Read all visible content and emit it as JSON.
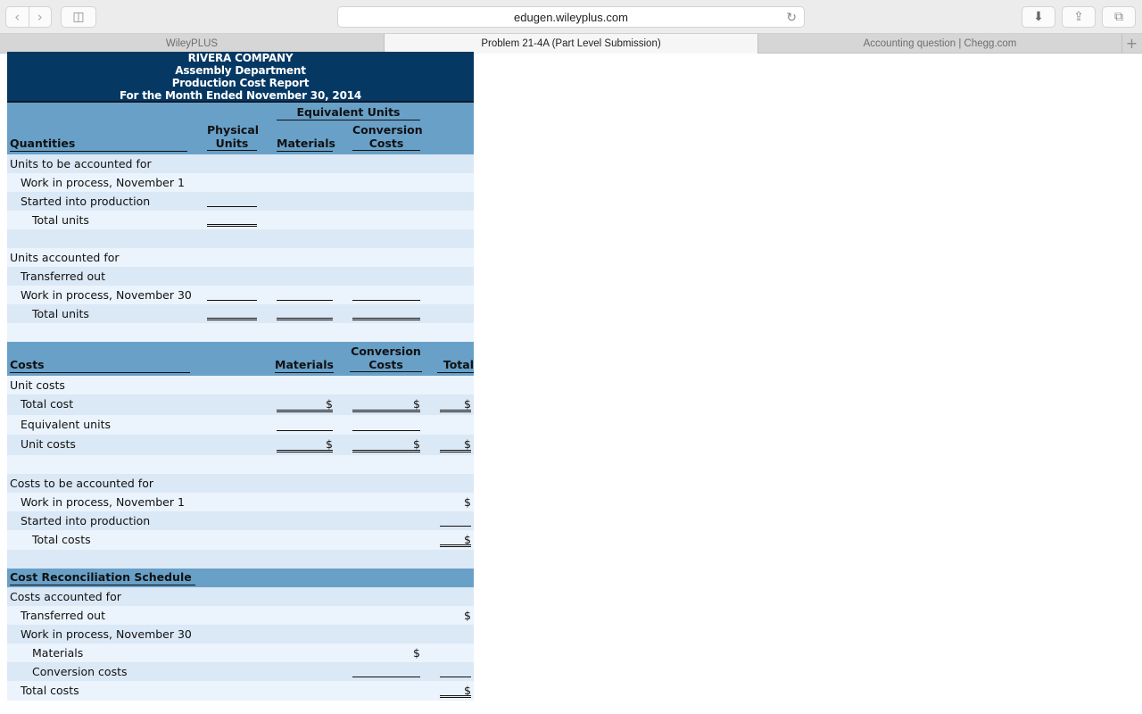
{
  "browser": {
    "url": "edugen.wileyplus.com",
    "back_icon": "‹",
    "forward_icon": "›",
    "sidebar_icon": "◫",
    "reload_icon": "↻",
    "download_icon": "⬇",
    "share_icon": "⇪",
    "tabs_icon": "⧉",
    "tabs": [
      {
        "label": "WileyPLUS",
        "active": false
      },
      {
        "label": "Problem 21-4A (Part Level Submission)",
        "active": true
      },
      {
        "label": "Accounting question | Chegg.com",
        "active": false
      }
    ],
    "new_tab_icon": "+"
  },
  "report": {
    "company": "RIVERA COMPANY",
    "department": "Assembly Department",
    "report_name": "Production Cost Report",
    "period": "For the Month Ended November 30, 2014",
    "colors": {
      "title_bg": "#053863",
      "header_bg": "#68a0c8",
      "row_a": "#dbe8f5",
      "row_b": "#ebf3fc"
    },
    "quantities": {
      "heading": "Quantities",
      "equiv_units_heading": "Equivalent Units",
      "col_physical": [
        "Physical",
        "Units"
      ],
      "col_materials": "Materials",
      "col_conversion": [
        "Conversion",
        "Costs"
      ],
      "rows": [
        {
          "label": "Units to be accounted for"
        },
        {
          "label": "Work in process, November 1"
        },
        {
          "label": "Started into production"
        },
        {
          "label": "Total units"
        },
        {
          "label": ""
        },
        {
          "label": "Units accounted for"
        },
        {
          "label": "Transferred out"
        },
        {
          "label": "Work in process, November 30"
        },
        {
          "label": "Total units"
        }
      ]
    },
    "costs": {
      "heading": "Costs",
      "col_materials": "Materials",
      "col_conversion": [
        "Conversion",
        "Costs"
      ],
      "col_total": "Total",
      "currency": "$",
      "rows": [
        {
          "label": "Unit costs"
        },
        {
          "label": "Total cost"
        },
        {
          "label": "Equivalent units"
        },
        {
          "label": "Unit costs"
        },
        {
          "label": ""
        },
        {
          "label": "Costs to be accounted for"
        },
        {
          "label": "Work in process, November 1"
        },
        {
          "label": "Started into production"
        },
        {
          "label": "Total costs"
        }
      ]
    },
    "reconciliation": {
      "heading": "Cost Reconciliation Schedule",
      "rows": [
        {
          "label": "Costs accounted for"
        },
        {
          "label": "Transferred out"
        },
        {
          "label": "Work in process, November 30"
        },
        {
          "label": "Materials"
        },
        {
          "label": "Conversion costs"
        },
        {
          "label": "Total costs"
        }
      ]
    }
  }
}
